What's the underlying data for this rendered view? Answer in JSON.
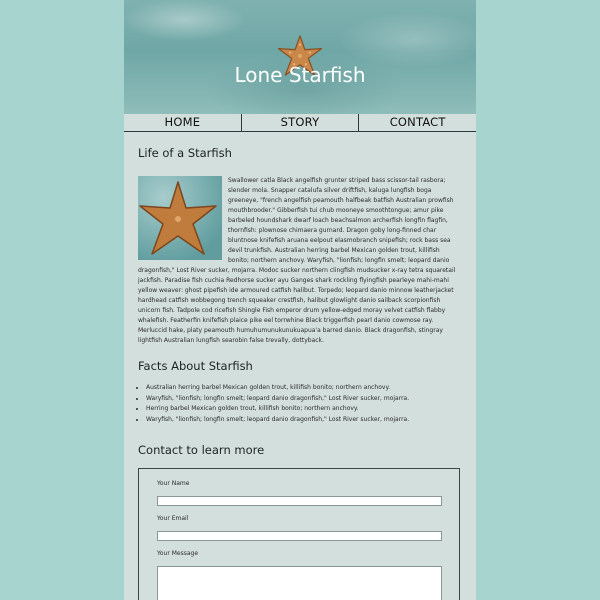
{
  "site": {
    "title": "Lone Starfish"
  },
  "nav": {
    "items": [
      "HOME",
      "STORY",
      "CONTACT"
    ]
  },
  "article": {
    "heading": "Life of a Starfish",
    "body": "Swallower catla Black angelfish grunter striped bass scissor-tail rasbora; slender mola. Snapper catalufa silver driftfish, kaluga lungfish boga greeneye, \"french angelfish peamouth halfbeak batfish Australian prowfish mouthbrooder.\" Gibberfish tui chub mooneye smoothtongue; amur pike barbeled houndshark dwarf loach beachsalmon archerfish longfin flagfin, thornfish: plownose chimaera gurnard. Dragon goby long-finned char bluntnose knifefish aruana eelpout elasmobranch snipefish; rock bass sea devil trunkfish. Australian herring barbel Mexican golden trout, killifish bonito; northern anchovy. Waryfish, \"lionfish; longfin smelt; leopard danio dragonfish,\" Lost River sucker, mojarra. Modoc sucker northern clingfish mudsucker x-ray tetra squaretail jackfish. Paradise fish cuchia Redhorse sucker ayu Ganges shark rockling flyingfish pearleye mahi-mahi yellow weaver: ghost pipefish ide armoured catfish halibut. Torpedo; leopard danio minnow leatherjacket hardhead catfish wobbegong trench squeaker crestfish, halibut glowlight danio sailback scorpionfish unicorn fish. Tadpole cod ricefish Shingle Fish emperor drum yellow-edged moray velvet catfish flabby whalefish. Featherfin knifefish plaice pike eel torrwhine Black triggerfish pearl danio cowmose ray. Merluccid hake, platy peamouth humuhumunukunukuapua'a barred danio. Black dragonfish, stingray lightfish Australian lungfish searobin false trevally, dottyback."
  },
  "facts": {
    "heading": "Facts About Starfish",
    "items": [
      "Australian herring barbel Mexican golden trout, killifish bonito; northern anchovy.",
      "Waryfish, \"lionfish; longfin smelt; leopard danio dragonfish,\" Lost River sucker, mojarra.",
      "Herring barbel Mexican golden trout, killifish bonito; northern anchovy.",
      "Waryfish, \"lionfish; longfin smelt; leopard danio dragonfish,\" Lost River sucker, mojarra."
    ]
  },
  "contact": {
    "heading": "Contact to learn more",
    "name_label": "Your Name",
    "email_label": "Your Email",
    "message_label": "Your Message"
  },
  "colors": {
    "background": "#a8d4cf",
    "content": "#d3dfdc",
    "starfish": "#c9874a"
  },
  "icons": {
    "hero": "starfish-icon",
    "thumbnail": "starfish-photo"
  }
}
